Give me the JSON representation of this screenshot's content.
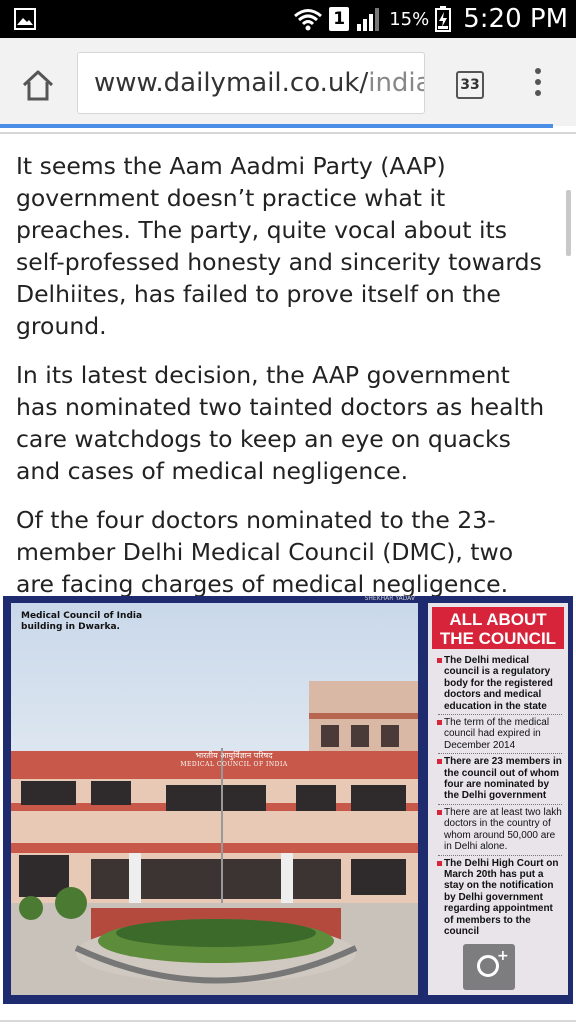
{
  "status_bar": {
    "sim_label": "1",
    "battery_percent": "15%",
    "time": "5:20 PM"
  },
  "browser": {
    "url_main": "www.dailymail.co.uk/",
    "url_tail": "india",
    "tab_count": "33",
    "progress": 0.96
  },
  "article": {
    "paragraphs": [
      "It seems the Aam Aadmi Party (AAP) government doesn’t practice what it preaches. The party, quite vocal about its self-professed honesty and sincerity towards Delhiites, has failed to prove itself on the ground.",
      "In its latest decision, the AAP government has nominated two tainted doctors as health care watchdogs to keep an eye on quacks and cases of medical negligence.",
      "Of the four doctors nominated to the 23-member Delhi Medical Council (DMC), two are facing charges of medical negligence."
    ]
  },
  "image": {
    "photo_credit": "SHEKHAR YADAV",
    "caption": "Medical Council of India building in Dwarka.",
    "building_sign_hindi": "भारतीय आयुर्विज्ञान परिषद",
    "building_sign_english": "MEDICAL COUNCIL OF INDIA",
    "sidebar_title": "ALL ABOUT THE COUNCIL",
    "sidebar_items": [
      "The Delhi medical council is a regulatory body for the registered doctors and medical education in the state",
      "The term of the medical council had expired in December 2014",
      "There are 23 members in the council out of whom four are nominated by the Delhi government",
      "There are at least two lakh doctors in the country of whom around 50,000 are in Delhi alone.",
      "The Delhi High Court on March 20th has put a stay on the notification by Delhi government regarding appointment of members to the council"
    ]
  },
  "colors": {
    "accent_blue": "#4a8ee8",
    "frame_navy": "#1e2b6e",
    "sidebar_red": "#d7243a"
  },
  "icons": [
    "gallery-icon",
    "wifi-icon",
    "signal-icon",
    "battery-icon",
    "home-icon",
    "tabs-icon",
    "overflow-menu-icon",
    "zoom-icon"
  ]
}
